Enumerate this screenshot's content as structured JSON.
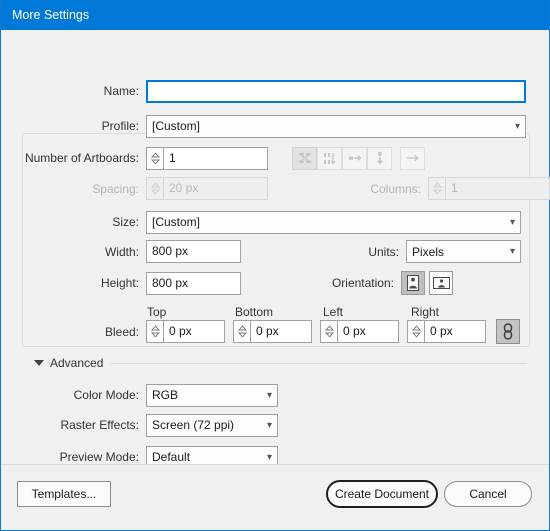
{
  "window": {
    "title": "More Settings",
    "titlebar_color": "#0078d7",
    "background_color": "#f0f0f0",
    "accent_color": "#0078d7"
  },
  "form": {
    "name": {
      "label": "Name:",
      "value": "",
      "placeholder": "",
      "focused": true
    },
    "profile": {
      "label": "Profile:",
      "value": "[Custom]"
    },
    "artboards": {
      "label": "Number of Artboards:",
      "value": "1",
      "arrange_buttons": [
        {
          "name": "grid-by-row-icon",
          "selected": true
        },
        {
          "name": "grid-by-column-icon",
          "selected": false
        },
        {
          "name": "arrange-by-row-icon",
          "selected": false
        },
        {
          "name": "arrange-by-column-icon",
          "selected": false
        }
      ],
      "direction_button": {
        "name": "right-to-left-arrow-icon"
      }
    },
    "spacing": {
      "label": "Spacing:",
      "value": "20 px",
      "disabled": true
    },
    "columns": {
      "label": "Columns:",
      "value": "1",
      "disabled": true
    },
    "size": {
      "label": "Size:",
      "value": "[Custom]"
    },
    "width": {
      "label": "Width:",
      "value": "800 px"
    },
    "height": {
      "label": "Height:",
      "value": "800 px"
    },
    "units": {
      "label": "Units:",
      "value": "Pixels"
    },
    "orientation": {
      "label": "Orientation:",
      "options": [
        {
          "name": "portrait-icon",
          "selected": true
        },
        {
          "name": "landscape-icon",
          "selected": false
        }
      ]
    },
    "bleed": {
      "label": "Bleed:",
      "headers": {
        "top": "Top",
        "bottom": "Bottom",
        "left": "Left",
        "right": "Right"
      },
      "top": "0 px",
      "bottom": "0 px",
      "left": "0 px",
      "right": "0 px",
      "link_button": {
        "name": "link-chain-icon",
        "selected": true
      }
    }
  },
  "advanced": {
    "label": "Advanced",
    "expanded": true,
    "color_mode": {
      "label": "Color Mode:",
      "value": "RGB"
    },
    "raster_effects": {
      "label": "Raster Effects:",
      "value": "Screen (72 ppi)"
    },
    "preview_mode": {
      "label": "Preview Mode:",
      "value": "Default"
    }
  },
  "footer": {
    "templates": "Templates...",
    "create": "Create Document",
    "cancel": "Cancel"
  }
}
